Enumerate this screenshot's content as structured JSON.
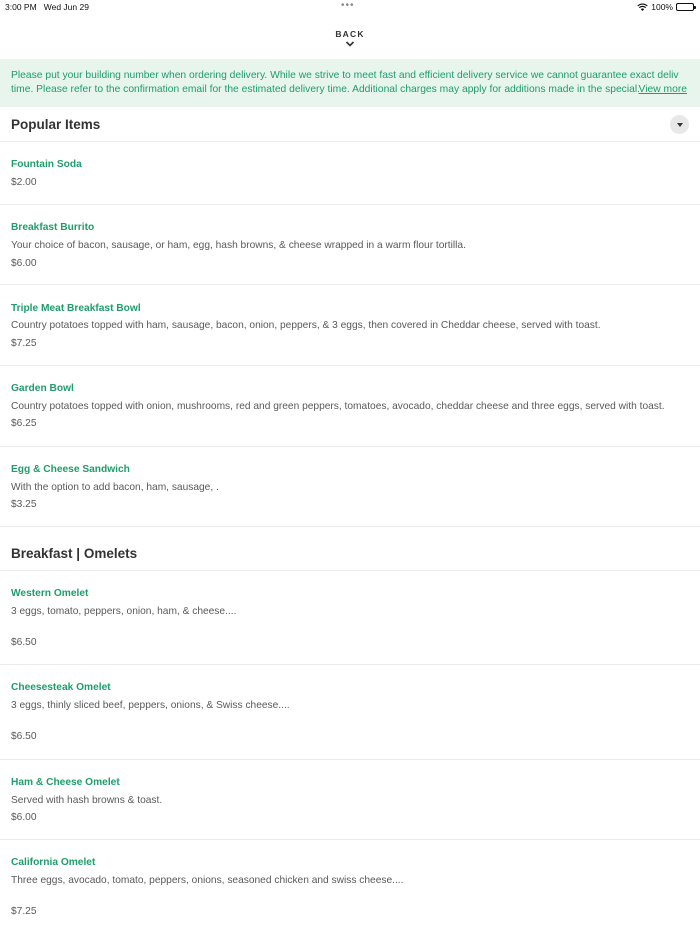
{
  "status": {
    "time": "3:00 PM",
    "date": "Wed Jun 29",
    "battery": "100%"
  },
  "nav": {
    "back_label": "BACK"
  },
  "notice": {
    "line1": "Please put your building number when ordering delivery. While we strive to meet fast and efficient delivery service we cannot guarantee exact deliv",
    "line2": "time. Please refer to the confirmation email for the estimated delivery time. Additional charges may apply for additions made in the special...",
    "view_more": "View more"
  },
  "popular": {
    "title": "Popular Items",
    "items": [
      {
        "name": "Fountain Soda",
        "desc": "",
        "price": "$2.00"
      },
      {
        "name": "Breakfast Burrito",
        "desc": "Your choice of bacon, sausage, or ham, egg, hash browns, & cheese wrapped in a warm flour tortilla.",
        "price": "$6.00"
      },
      {
        "name": "Triple Meat Breakfast Bowl",
        "desc": "Country potatoes topped with ham, sausage, bacon, onion, peppers, & 3 eggs, then covered in Cheddar cheese, served with toast.",
        "price": "$7.25"
      },
      {
        "name": "Garden Bowl",
        "desc": "Country potatoes topped with onion, mushrooms, red and green peppers, tomatoes, avocado, cheddar cheese and three eggs, served with toast.",
        "price": "$6.25"
      },
      {
        "name": "Egg & Cheese Sandwich",
        "desc": "With the option to add bacon, ham, sausage,   .",
        "price": "$3.25"
      }
    ]
  },
  "omelets": {
    "title": "Breakfast | Omelets",
    "items": [
      {
        "name": "Western Omelet",
        "desc": "3 eggs, tomato, peppers, onion, ham, & cheese....",
        "price": "$6.50"
      },
      {
        "name": "Cheesesteak Omelet",
        "desc": "3 eggs, thinly sliced beef, peppers, onions, & Swiss cheese....",
        "price": "$6.50"
      },
      {
        "name": "Ham & Cheese Omelet",
        "desc": "Served with hash browns & toast.",
        "price": "$6.00"
      },
      {
        "name": "California Omelet",
        "desc": "Three eggs, avocado, tomato, peppers, onions, seasoned chicken and swiss cheese....",
        "price": "$7.25"
      }
    ]
  },
  "colors": {
    "accent": "#1f9d6b",
    "notice_bg": "#e7f5ec"
  },
  "icons": [
    "wifi-icon",
    "battery-icon",
    "chevron-down-icon",
    "collapse-caret-icon"
  ]
}
